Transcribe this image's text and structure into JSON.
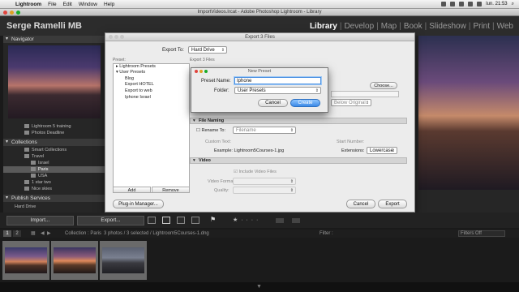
{
  "menubar": {
    "app": "Lightroom",
    "items": [
      "File",
      "Edit",
      "Window",
      "Help"
    ],
    "clock": "lun. 21:53"
  },
  "window": {
    "title": "ImportVideos.lrcat - Adobe Photoshop Lightroom - Library"
  },
  "identity_plate": "Serge Ramelli MB",
  "modules": [
    "Library",
    "Develop",
    "Map",
    "Book",
    "Slideshow",
    "Print",
    "Web"
  ],
  "left_panel": {
    "navigator_label": "Navigator",
    "folders": [
      "Lightroom 5 training",
      "Photos Deadline"
    ],
    "collections_label": "Collections",
    "collections": [
      "Smart Collections",
      "Travel",
      "Israel",
      "Paris",
      "USA",
      "1 star two",
      "Nice skies"
    ],
    "publish_label": "Publish Services",
    "publish": [
      "Hard Drive"
    ],
    "import_button": "Import...",
    "export_button": "Export..."
  },
  "export_dialog": {
    "title": "Export 3 Files",
    "export_to_label": "Export To:",
    "export_to_value": "Hard Drive",
    "preset_header": "Preset:",
    "export_files_header": "Export 3 Files",
    "presets": [
      "Lightroom Presets",
      "User Presets",
      "Blog",
      "Export HOTEL",
      "Export to web",
      "Iphone Israel"
    ],
    "add_label": "Add",
    "remove_label": "Remove",
    "choose_label": "Choose...",
    "below_original": "Below Original",
    "file_naming_label": "File Naming",
    "rename_to_label": "Rename To:",
    "rename_to_value": "Filename",
    "custom_text_label": "Custom Text:",
    "start_number_label": "Start Number:",
    "example_label": "Example:",
    "example_value": "Lightroom5Courses-1.jpg",
    "extensions_label": "Extensions:",
    "extensions_value": "Lowercase",
    "video_label": "Video",
    "include_video_label": "Include Video Files",
    "video_format_label": "Video Format:",
    "quality_label": "Quality:",
    "plugin_button": "Plug-in Manager...",
    "cancel_button": "Cancel",
    "export_button": "Export"
  },
  "new_preset": {
    "title": "New Preset",
    "name_label": "Preset Name:",
    "name_value": "Iphone",
    "folder_label": "Folder:",
    "folder_value": "User Presets",
    "cancel_button": "Cancel",
    "create_button": "Create"
  },
  "filmstrip": {
    "page_buttons": [
      "1",
      "2"
    ],
    "path": "Collection : Paris",
    "count": "3 photos / 3 selected / Lightroom5Courses-1.dng",
    "filter_label": "Filter :",
    "filter_value": "Filters Off"
  },
  "colors": {
    "accent": "#3a89e6",
    "panel": "#262626"
  }
}
